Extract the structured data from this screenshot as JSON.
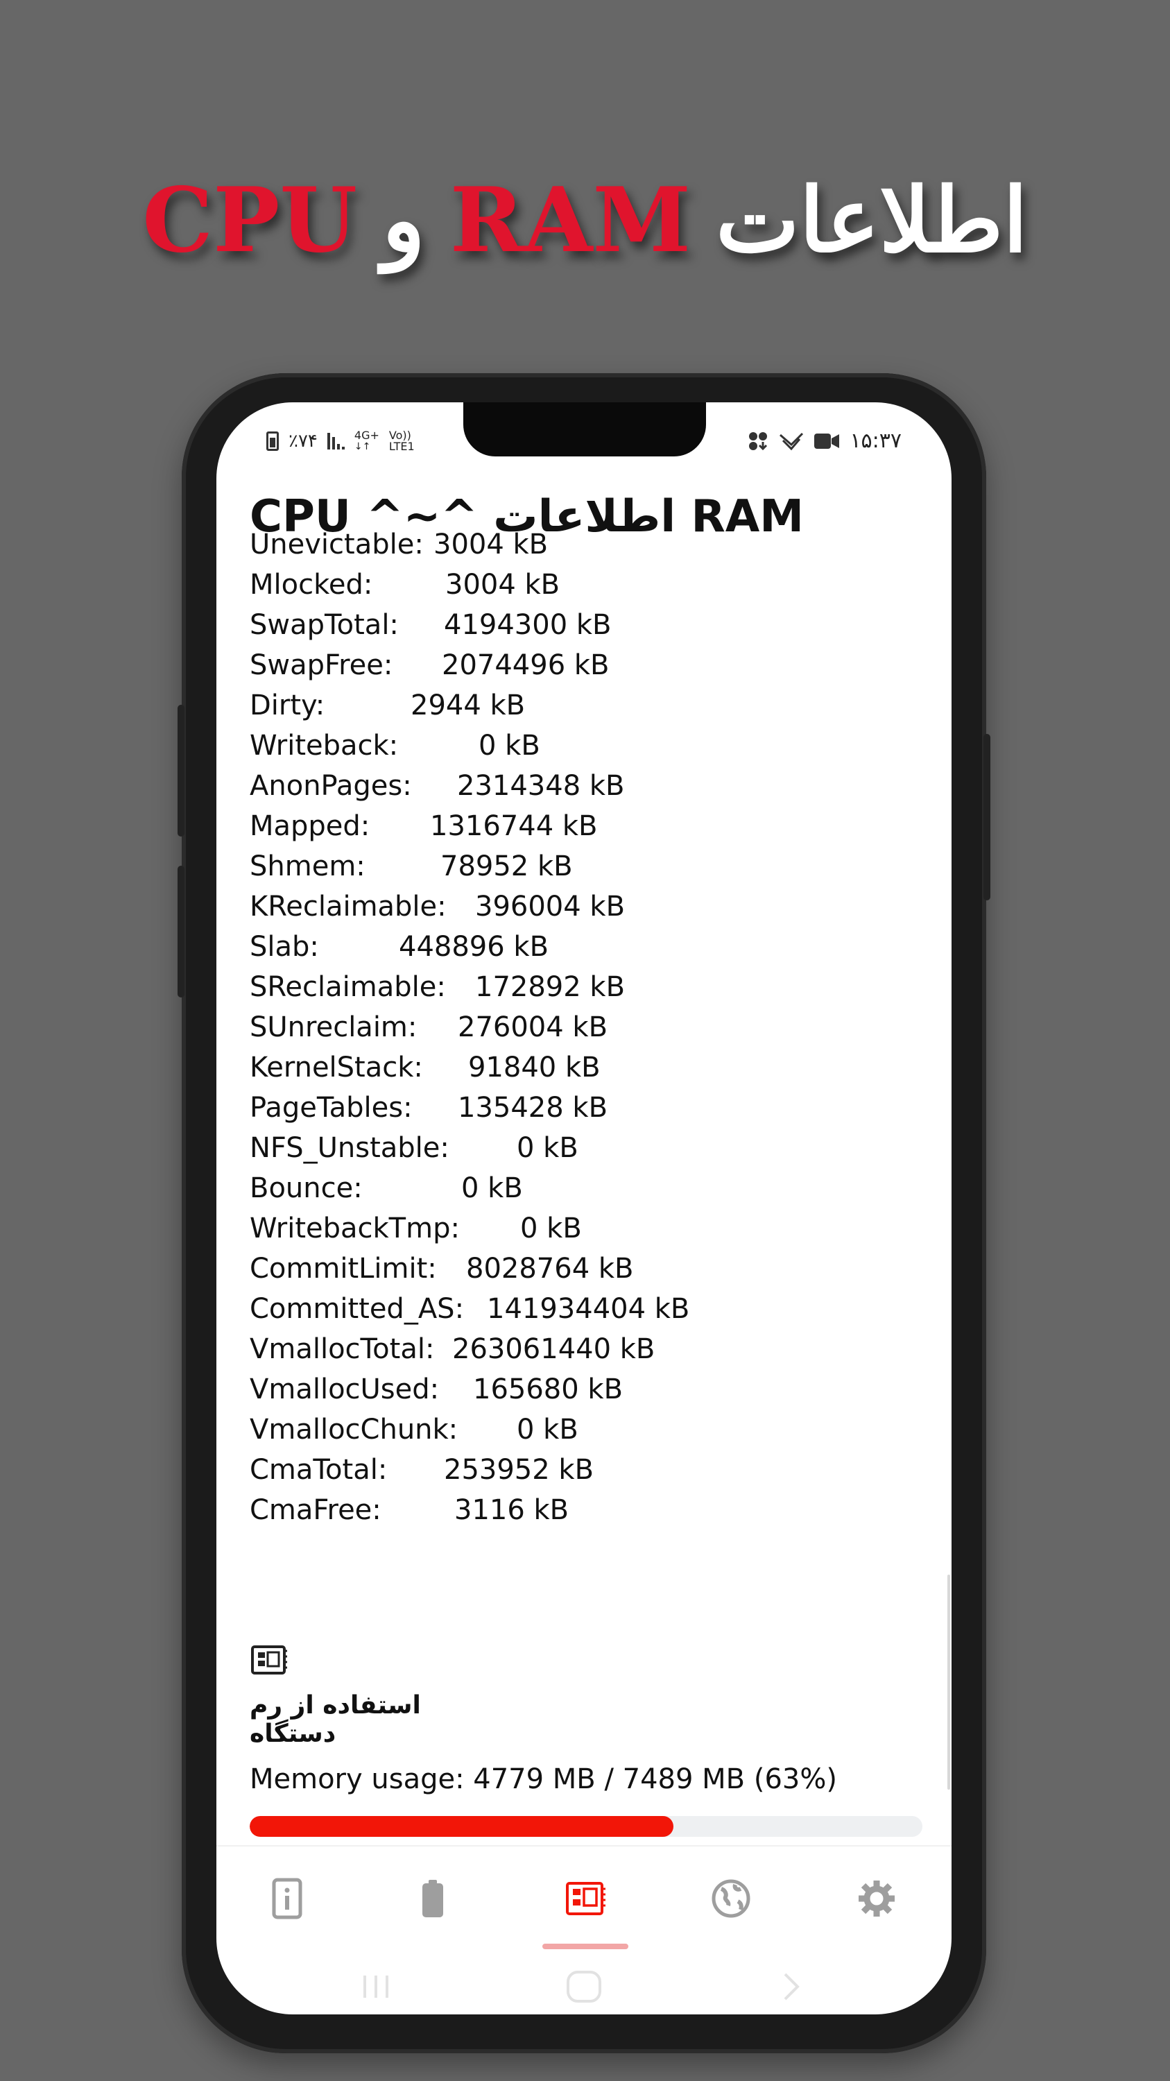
{
  "promo": {
    "title_fa": "اطلاعات",
    "title_ram": "RAM",
    "title_and": "و",
    "title_cpu": "CPU"
  },
  "status_bar": {
    "battery": "٪۷۴",
    "network_top": "4G+",
    "network_bottom": "LTE1",
    "volte": "Vo))",
    "time": "۱۵:۳۷"
  },
  "page": {
    "heading": "CPU ^~^ اطلاعات RAM"
  },
  "meminfo": [
    {
      "label": "Unevictable:",
      "value": "3004 kB"
    },
    {
      "label": "Mlocked:",
      "value": "3004 kB"
    },
    {
      "label": "SwapTotal:",
      "value": "4194300 kB"
    },
    {
      "label": "SwapFree:",
      "value": "2074496 kB"
    },
    {
      "label": "Dirty:",
      "value": "2944 kB"
    },
    {
      "label": "Writeback:",
      "value": "0 kB"
    },
    {
      "label": "AnonPages:",
      "value": "2314348 kB"
    },
    {
      "label": "Mapped:",
      "value": "1316744 kB"
    },
    {
      "label": "Shmem:",
      "value": "78952 kB"
    },
    {
      "label": "KReclaimable:",
      "value": "396004 kB"
    },
    {
      "label": "Slab:",
      "value": "448896 kB"
    },
    {
      "label": "SReclaimable:",
      "value": "172892 kB"
    },
    {
      "label": "SUnreclaim:",
      "value": "276004 kB"
    },
    {
      "label": "KernelStack:",
      "value": "91840 kB"
    },
    {
      "label": "PageTables:",
      "value": "135428 kB"
    },
    {
      "label": "NFS_Unstable:",
      "value": "0 kB"
    },
    {
      "label": "Bounce:",
      "value": "0 kB"
    },
    {
      "label": "WritebackTmp:",
      "value": "0 kB"
    },
    {
      "label": "CommitLimit:",
      "value": "8028764 kB"
    },
    {
      "label": "Committed_AS:",
      "value": "141934404 kB"
    },
    {
      "label": "VmallocTotal:",
      "value": "263061440 kB"
    },
    {
      "label": "VmallocUsed:",
      "value": "165680 kB"
    },
    {
      "label": "VmallocChunk:",
      "value": "0 kB"
    },
    {
      "label": "CmaTotal:",
      "value": "253952 kB"
    },
    {
      "label": "CmaFree:",
      "value": "3116 kB"
    }
  ],
  "ram_usage": {
    "icon": "memory-chip-icon",
    "caption": "استفاده از رم دستگاه",
    "text": "Memory usage: 4779 MB / 7489 MB (63%)",
    "percent": 63
  },
  "bottom_nav": {
    "items": [
      {
        "name": "info",
        "icon": "info-icon"
      },
      {
        "name": "battery",
        "icon": "battery-icon"
      },
      {
        "name": "memory",
        "icon": "memory-chip-icon",
        "active": true
      },
      {
        "name": "network",
        "icon": "globe-icon"
      },
      {
        "name": "settings",
        "icon": "gear-icon"
      }
    ]
  },
  "colors": {
    "background": "#676767",
    "accent": "#f21608",
    "promo_red": "#e0142d",
    "nav_inactive": "#9e9e9e"
  }
}
